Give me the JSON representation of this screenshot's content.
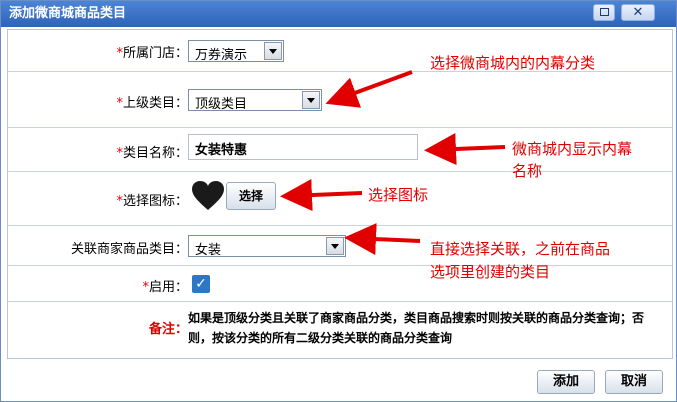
{
  "window": {
    "title": "添加微商城商品类目"
  },
  "form": {
    "store": {
      "required": "*",
      "label": "所属门店：",
      "value": "万券演示"
    },
    "parent_category": {
      "required": "*",
      "label": "上级类目：",
      "value": "顶级类目"
    },
    "category_name": {
      "required": "*",
      "label": "类目名称：",
      "value": "女装特惠"
    },
    "icon": {
      "required": "*",
      "label": "选择图标：",
      "icon_name": "heart-icon",
      "button_label": "选择"
    },
    "linked_category": {
      "label": "关联商家商品类目：",
      "value": "女装"
    },
    "enabled": {
      "required": "*",
      "label": "启用：",
      "checked": true,
      "check_glyph": "✓"
    },
    "note": {
      "label": "备注：",
      "text": "如果是顶级分类且关联了商家商品分类，类目商品搜索时则按关联的商品分类查询；否则，按该分类的所有二级分类关联的商品分类查询"
    }
  },
  "footer": {
    "add_label": "添加",
    "cancel_label": "取消"
  },
  "annotations": {
    "parent_category": "选择微商城内的内幕分类",
    "category_name_line1": "微商城内显示内幕",
    "category_name_line2": "名称",
    "icon": "选择图标",
    "linked_line1": "直接选择关联，之前在商品",
    "linked_line2": "选项里创建的类目"
  },
  "colors": {
    "title_bar": "#2e63b8",
    "required": "#e00000",
    "annotation": "#e00000",
    "checkbox": "#2c78c6"
  }
}
